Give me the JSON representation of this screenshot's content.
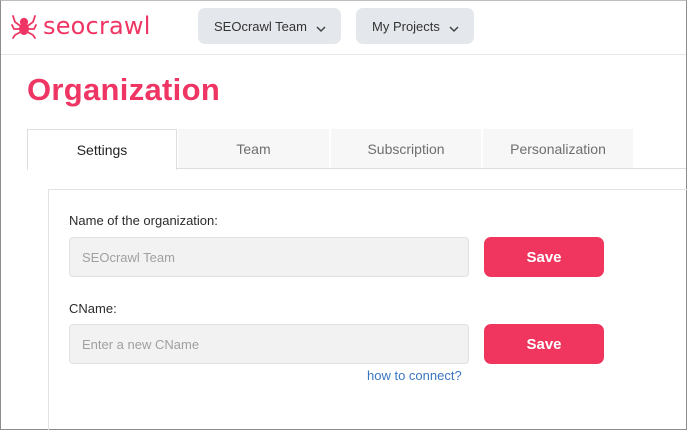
{
  "header": {
    "logo_text": "seocrawl",
    "team_dropdown": "SEOcrawl Team",
    "projects_dropdown": "My Projects"
  },
  "page": {
    "title": "Organization"
  },
  "tabs": [
    {
      "label": "Settings",
      "active": true
    },
    {
      "label": "Team",
      "active": false
    },
    {
      "label": "Subscription",
      "active": false
    },
    {
      "label": "Personalization",
      "active": false
    }
  ],
  "form": {
    "org_name": {
      "label": "Name of the organization:",
      "placeholder": "SEOcrawl Team",
      "value": ""
    },
    "cname": {
      "label": "CName:",
      "placeholder": "Enter a new CName",
      "value": "",
      "help_link": "how to connect?"
    },
    "save_label": "Save"
  },
  "colors": {
    "accent": "#ee3563",
    "button": "#f0365f",
    "link": "#3a76c2",
    "dropdown_bg": "#e4e7eb"
  },
  "icons": {
    "logo": "spider-icon",
    "dropdown": "chevron-down-icon"
  }
}
